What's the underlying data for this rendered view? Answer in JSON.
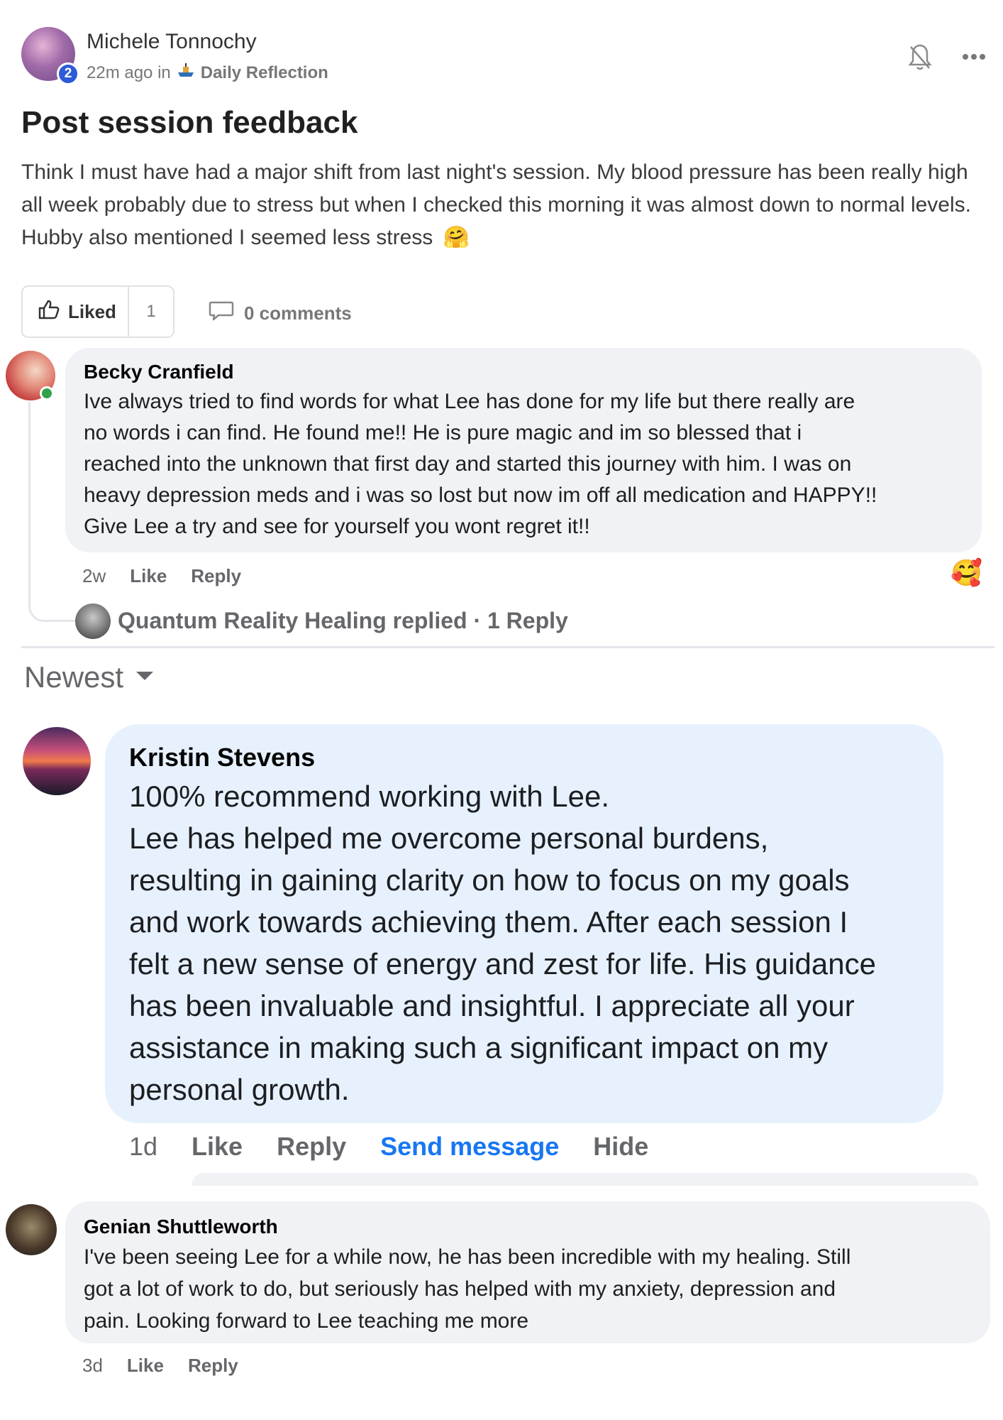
{
  "post": {
    "author": "Michele Tonnochy",
    "badge": "2",
    "time": "22m ago in",
    "category": "Daily Reflection",
    "title": "Post session feedback",
    "body_lines": [
      "Think I must have had a major shift from last night's session. My blood pressure has been really high",
      "all week probably due to stress but when I checked this morning it was almost down to normal levels.",
      "Hubby also mentioned I seemed less stress"
    ],
    "emoji": "🤗",
    "liked_label": "Liked",
    "like_count": "1",
    "comments_label": "0 comments"
  },
  "comment_becky": {
    "name": "Becky Cranfield",
    "lines": [
      "Ive always tried to find words for what Lee has done for my life but there really are",
      "no words i can find. He found me!! He is pure magic and im so blessed that i",
      "reached into the unknown that first day and started this journey with him. I was on",
      "heavy depression meds and i was so lost but now im off all medication and HAPPY!!",
      "Give Lee a try and see for yourself you wont regret it!!"
    ],
    "time": "2w",
    "like": "Like",
    "reply": "Reply",
    "reaction": "🥰",
    "replied_text": "Quantum Reality Healing replied · 1 Reply"
  },
  "sort": {
    "label": "Newest"
  },
  "comment_kristin": {
    "name": "Kristin Stevens",
    "lines": [
      "100% recommend working with Lee.",
      "Lee has helped me overcome personal burdens,",
      "resulting in gaining clarity on how to focus on my goals",
      "and work towards achieving them. After each session I",
      "felt a new sense of energy and zest for life. His guidance",
      "has been invaluable and insightful. I appreciate all your",
      "assistance in making such a significant impact on my",
      "personal growth."
    ],
    "time": "1d",
    "like": "Like",
    "reply": "Reply",
    "send_message": "Send message",
    "hide": "Hide"
  },
  "comment_genian": {
    "name": "Genian Shuttleworth",
    "lines": [
      "I've been seeing Lee for a while now, he has been incredible with my healing. Still",
      "got a lot of work to do, but seriously has helped with my anxiety, depression and",
      "pain. Looking forward to Lee teaching me more"
    ],
    "time": "3d",
    "like": "Like",
    "reply": "Reply"
  },
  "colors": {
    "link_blue": "#1877f2",
    "badge_blue": "#2d5bd8",
    "bubble_gray": "#f0f2f5",
    "bubble_blue": "#e7f1fd",
    "online_green": "#31a24c"
  },
  "icons": [
    "bell-off-icon",
    "more-icon",
    "category-icon",
    "thumbs-up-icon",
    "comment-icon",
    "chevron-down-icon"
  ]
}
